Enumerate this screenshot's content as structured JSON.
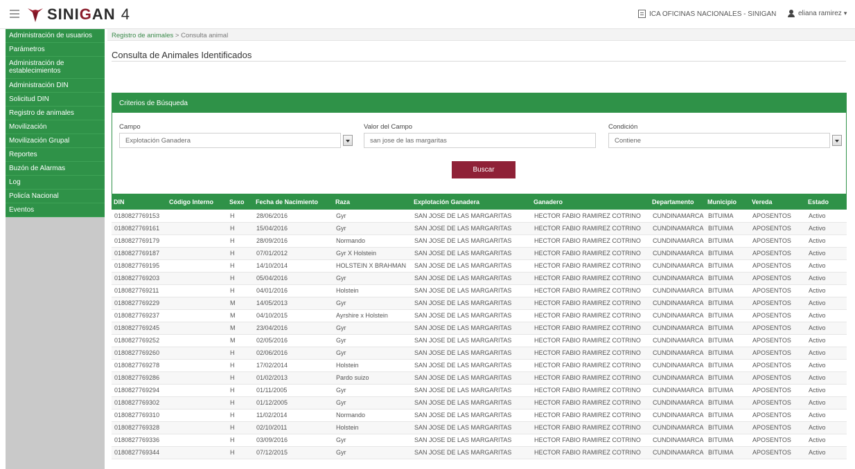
{
  "header": {
    "logo_text_1": "SINI",
    "logo_text_2": "G",
    "logo_text_3": "AN",
    "version": "4",
    "office": "ICA OFICINAS NACIONALES - SINIGAN",
    "user": "eliana ramirez"
  },
  "sidebar": {
    "items": [
      {
        "label": "Administración de usuarios"
      },
      {
        "label": "Parámetros"
      },
      {
        "label": "Administración de establecimientos"
      },
      {
        "label": "Administración DIN"
      },
      {
        "label": "Solicitud DIN"
      },
      {
        "label": "Registro de animales"
      },
      {
        "label": "Movilización"
      },
      {
        "label": "Movilización Grupal"
      },
      {
        "label": "Reportes"
      },
      {
        "label": "Buzón de Alarmas"
      },
      {
        "label": "Log"
      },
      {
        "label": "Policía Nacional"
      },
      {
        "label": "Eventos"
      }
    ]
  },
  "breadcrumb": {
    "parent": "Registro de animales",
    "separator": " > ",
    "current": "Consulta animal"
  },
  "page": {
    "title": "Consulta de Animales Identificados"
  },
  "criteria": {
    "heading": "Criterios de Búsqueda",
    "campo_label": "Campo",
    "campo_value": "Explotación Ganadera",
    "valor_label": "Valor del Campo",
    "valor_value": "san jose de las margaritas",
    "condicion_label": "Condición",
    "condicion_value": "Contiene",
    "search_button": "Buscar"
  },
  "table": {
    "columns": [
      "DIN",
      "Código Interno",
      "Sexo",
      "Fecha de Nacimiento",
      "Raza",
      "Explotación Ganadera",
      "Ganadero",
      "Departamento",
      "Municipio",
      "Vereda",
      "Estado"
    ],
    "rows": [
      [
        "0180827769153",
        "",
        "H",
        "28/06/2016",
        "Gyr",
        "SAN JOSE DE LAS MARGARITAS",
        "HECTOR FABIO RAMIREZ COTRINO",
        "CUNDINAMARCA",
        "BITUIMA",
        "APOSENTOS",
        "Activo"
      ],
      [
        "0180827769161",
        "",
        "H",
        "15/04/2016",
        "Gyr",
        "SAN JOSE DE LAS MARGARITAS",
        "HECTOR FABIO RAMIREZ COTRINO",
        "CUNDINAMARCA",
        "BITUIMA",
        "APOSENTOS",
        "Activo"
      ],
      [
        "0180827769179",
        "",
        "H",
        "28/09/2016",
        "Normando",
        "SAN JOSE DE LAS MARGARITAS",
        "HECTOR FABIO RAMIREZ COTRINO",
        "CUNDINAMARCA",
        "BITUIMA",
        "APOSENTOS",
        "Activo"
      ],
      [
        "0180827769187",
        "",
        "H",
        "07/01/2012",
        "Gyr X Holstein",
        "SAN JOSE DE LAS MARGARITAS",
        "HECTOR FABIO RAMIREZ COTRINO",
        "CUNDINAMARCA",
        "BITUIMA",
        "APOSENTOS",
        "Activo"
      ],
      [
        "0180827769195",
        "",
        "H",
        "14/10/2014",
        "HOLSTEIN X BRAHMAN",
        "SAN JOSE DE LAS MARGARITAS",
        "HECTOR FABIO RAMIREZ COTRINO",
        "CUNDINAMARCA",
        "BITUIMA",
        "APOSENTOS",
        "Activo"
      ],
      [
        "0180827769203",
        "",
        "H",
        "05/04/2016",
        "Gyr",
        "SAN JOSE DE LAS MARGARITAS",
        "HECTOR FABIO RAMIREZ COTRINO",
        "CUNDINAMARCA",
        "BITUIMA",
        "APOSENTOS",
        "Activo"
      ],
      [
        "0180827769211",
        "",
        "H",
        "04/01/2016",
        "Holstein",
        "SAN JOSE DE LAS MARGARITAS",
        "HECTOR FABIO RAMIREZ COTRINO",
        "CUNDINAMARCA",
        "BITUIMA",
        "APOSENTOS",
        "Activo"
      ],
      [
        "0180827769229",
        "",
        "M",
        "14/05/2013",
        "Gyr",
        "SAN JOSE DE LAS MARGARITAS",
        "HECTOR FABIO RAMIREZ COTRINO",
        "CUNDINAMARCA",
        "BITUIMA",
        "APOSENTOS",
        "Activo"
      ],
      [
        "0180827769237",
        "",
        "M",
        "04/10/2015",
        "Ayrshire x Holstein",
        "SAN JOSE DE LAS MARGARITAS",
        "HECTOR FABIO RAMIREZ COTRINO",
        "CUNDINAMARCA",
        "BITUIMA",
        "APOSENTOS",
        "Activo"
      ],
      [
        "0180827769245",
        "",
        "M",
        "23/04/2016",
        "Gyr",
        "SAN JOSE DE LAS MARGARITAS",
        "HECTOR FABIO RAMIREZ COTRINO",
        "CUNDINAMARCA",
        "BITUIMA",
        "APOSENTOS",
        "Activo"
      ],
      [
        "0180827769252",
        "",
        "M",
        "02/05/2016",
        "Gyr",
        "SAN JOSE DE LAS MARGARITAS",
        "HECTOR FABIO RAMIREZ COTRINO",
        "CUNDINAMARCA",
        "BITUIMA",
        "APOSENTOS",
        "Activo"
      ],
      [
        "0180827769260",
        "",
        "H",
        "02/06/2016",
        "Gyr",
        "SAN JOSE DE LAS MARGARITAS",
        "HECTOR FABIO RAMIREZ COTRINO",
        "CUNDINAMARCA",
        "BITUIMA",
        "APOSENTOS",
        "Activo"
      ],
      [
        "0180827769278",
        "",
        "H",
        "17/02/2014",
        "Holstein",
        "SAN JOSE DE LAS MARGARITAS",
        "HECTOR FABIO RAMIREZ COTRINO",
        "CUNDINAMARCA",
        "BITUIMA",
        "APOSENTOS",
        "Activo"
      ],
      [
        "0180827769286",
        "",
        "H",
        "01/02/2013",
        "Pardo suizo",
        "SAN JOSE DE LAS MARGARITAS",
        "HECTOR FABIO RAMIREZ COTRINO",
        "CUNDINAMARCA",
        "BITUIMA",
        "APOSENTOS",
        "Activo"
      ],
      [
        "0180827769294",
        "",
        "H",
        "01/11/2005",
        "Gyr",
        "SAN JOSE DE LAS MARGARITAS",
        "HECTOR FABIO RAMIREZ COTRINO",
        "CUNDINAMARCA",
        "BITUIMA",
        "APOSENTOS",
        "Activo"
      ],
      [
        "0180827769302",
        "",
        "H",
        "01/12/2005",
        "Gyr",
        "SAN JOSE DE LAS MARGARITAS",
        "HECTOR FABIO RAMIREZ COTRINO",
        "CUNDINAMARCA",
        "BITUIMA",
        "APOSENTOS",
        "Activo"
      ],
      [
        "0180827769310",
        "",
        "H",
        "11/02/2014",
        "Normando",
        "SAN JOSE DE LAS MARGARITAS",
        "HECTOR FABIO RAMIREZ COTRINO",
        "CUNDINAMARCA",
        "BITUIMA",
        "APOSENTOS",
        "Activo"
      ],
      [
        "0180827769328",
        "",
        "H",
        "02/10/2011",
        "Holstein",
        "SAN JOSE DE LAS MARGARITAS",
        "HECTOR FABIO RAMIREZ COTRINO",
        "CUNDINAMARCA",
        "BITUIMA",
        "APOSENTOS",
        "Activo"
      ],
      [
        "0180827769336",
        "",
        "H",
        "03/09/2016",
        "Gyr",
        "SAN JOSE DE LAS MARGARITAS",
        "HECTOR FABIO RAMIREZ COTRINO",
        "CUNDINAMARCA",
        "BITUIMA",
        "APOSENTOS",
        "Activo"
      ],
      [
        "0180827769344",
        "",
        "H",
        "07/12/2015",
        "Gyr",
        "SAN JOSE DE LAS MARGARITAS",
        "HECTOR FABIO RAMIREZ COTRINO",
        "CUNDINAMARCA",
        "BITUIMA",
        "APOSENTOS",
        "Activo"
      ]
    ]
  },
  "colors": {
    "primary_green": "#2f9248",
    "button_maroon": "#8f2137",
    "sidebar_gray": "#c9c9c9"
  }
}
